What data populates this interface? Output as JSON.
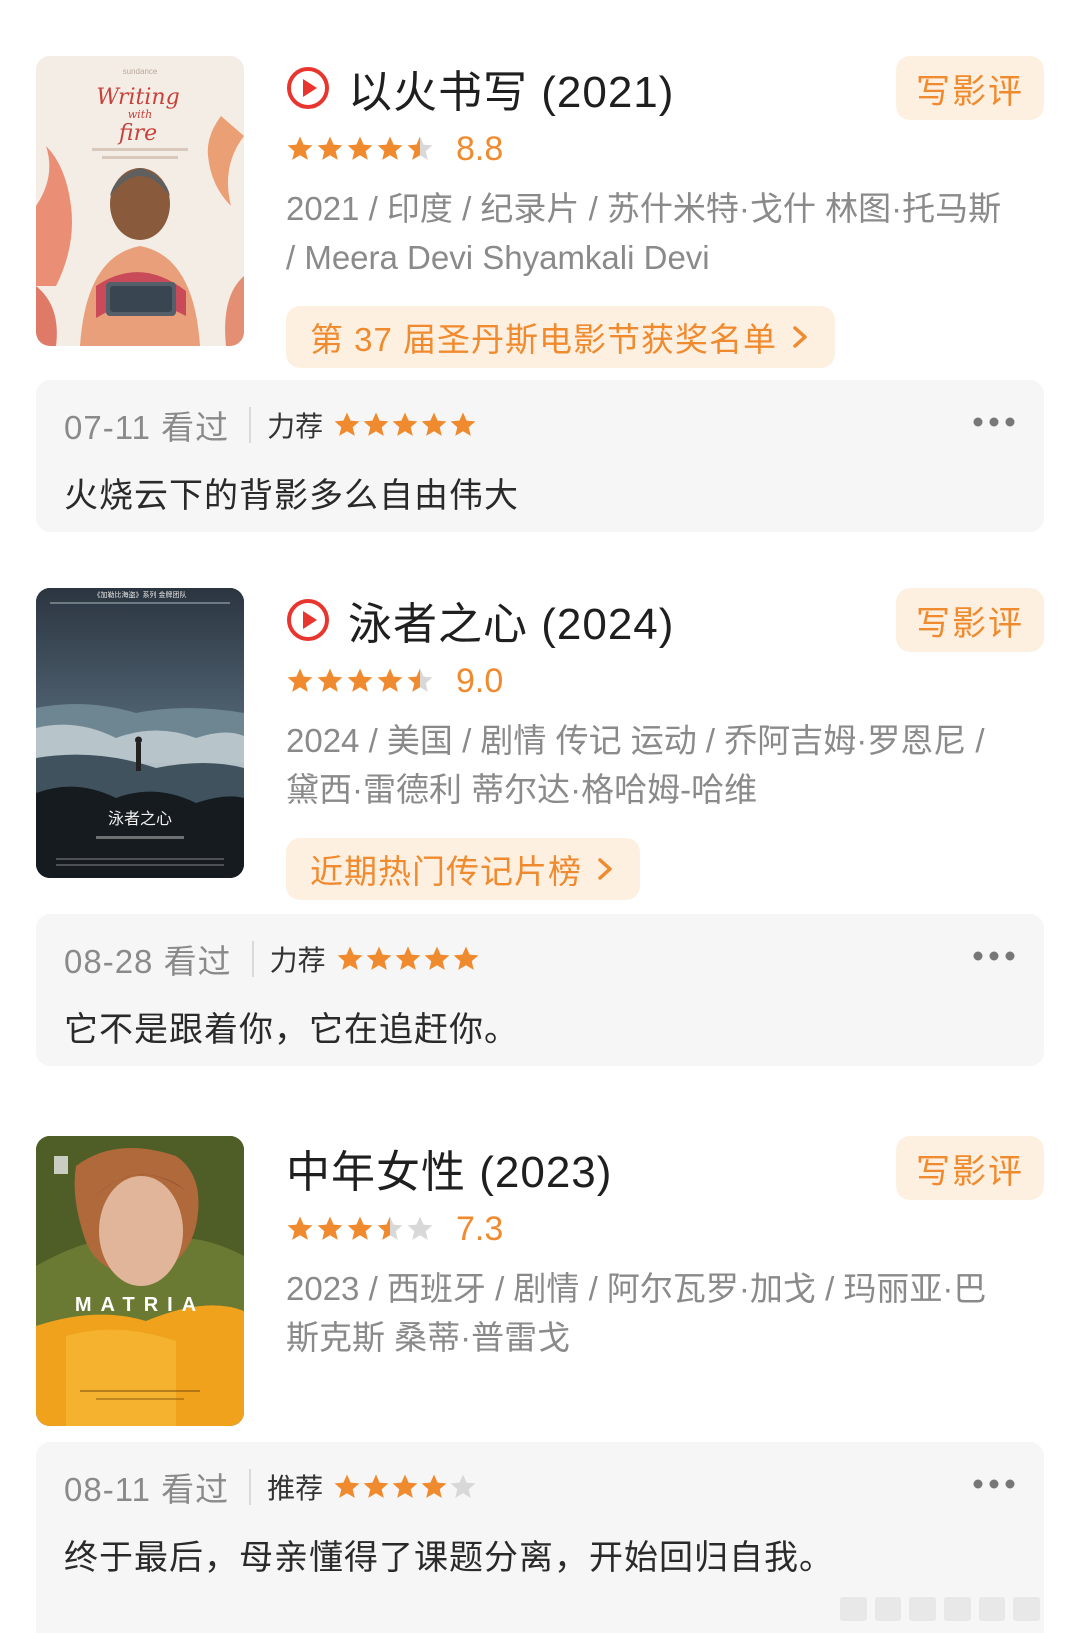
{
  "colors": {
    "accent": "#f08a2e",
    "accent_bg": "#fdf0e1",
    "play": "#e8362f",
    "star_empty": "#d8d8d8"
  },
  "movies": [
    {
      "title": "以火书写 (2021)",
      "has_play": true,
      "rating_stars": 4.5,
      "score": "8.8",
      "meta": "2021 / 印度 / 纪录片 / 苏什米特·戈什 林图·托马斯 / Meera Devi Shyamkali Devi",
      "review_button": "写影评",
      "list_chip": "第 37 届圣丹斯电影节获奖名单",
      "poster": {
        "text": [
          "Writing",
          "with",
          "fire"
        ],
        "header": "sundance"
      },
      "review": {
        "date": "07-11 看过",
        "level": "力荐",
        "stars": 5,
        "text": "火烧云下的背影多么自由伟大"
      }
    },
    {
      "title": "泳者之心 (2024)",
      "has_play": true,
      "rating_stars": 4.5,
      "score": "9.0",
      "meta": "2024 / 美国 / 剧情 传记 运动 / 乔阿吉姆·罗恩尼 / 黛西·雷德利 蒂尔达·格哈姆-哈维",
      "review_button": "写影评",
      "list_chip": "近期热门传记片榜",
      "poster": {
        "text": [
          "泳者之心"
        ],
        "header": "《加勒比海盗》系列 金牌团队"
      },
      "review": {
        "date": "08-28 看过",
        "level": "力荐",
        "stars": 5,
        "text": "它不是跟着你，它在追赶你。"
      }
    },
    {
      "title": "中年女性 (2023)",
      "has_play": false,
      "rating_stars": 3.5,
      "score": "7.3",
      "meta": "2023 / 西班牙 / 剧情 / 阿尔瓦罗·加戈 / 玛丽亚·巴斯克斯 桑蒂·普雷戈",
      "review_button": "写影评",
      "list_chip": "",
      "poster": {
        "text": [
          "MATRIA"
        ],
        "header": ""
      },
      "review": {
        "date": "08-11 看过",
        "level": "推荐",
        "stars": 4,
        "text": "终于最后，母亲懂得了课题分离，开始回归自我。"
      }
    }
  ]
}
